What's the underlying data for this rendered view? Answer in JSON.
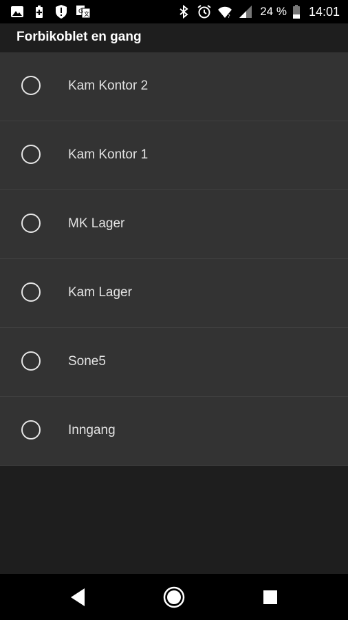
{
  "status_bar": {
    "left_icons": [
      "image-icon",
      "battery-saver-icon",
      "alert-icon",
      "translate-icon"
    ],
    "right_icons": [
      "bluetooth-icon",
      "alarm-icon",
      "wifi-icon",
      "signal-icon",
      "battery-icon"
    ],
    "battery_percent": "24 %",
    "time": "14:01"
  },
  "header": {
    "title": "Forbikoblet en gang"
  },
  "options": [
    {
      "label": "Kam Kontor 2",
      "selected": false
    },
    {
      "label": "Kam Kontor 1",
      "selected": false
    },
    {
      "label": "MK Lager",
      "selected": false
    },
    {
      "label": "Kam Lager",
      "selected": false
    },
    {
      "label": "Sone5",
      "selected": false
    },
    {
      "label": "Inngang",
      "selected": false
    }
  ],
  "nav_bar": {
    "buttons": [
      "back-icon",
      "home-icon",
      "recents-icon"
    ]
  },
  "colors": {
    "status_bar_bg": "#000000",
    "background": "#1e1e1e",
    "list_bg": "#333333",
    "divider": "#3f3f3f",
    "text": "#e3e3e3"
  }
}
